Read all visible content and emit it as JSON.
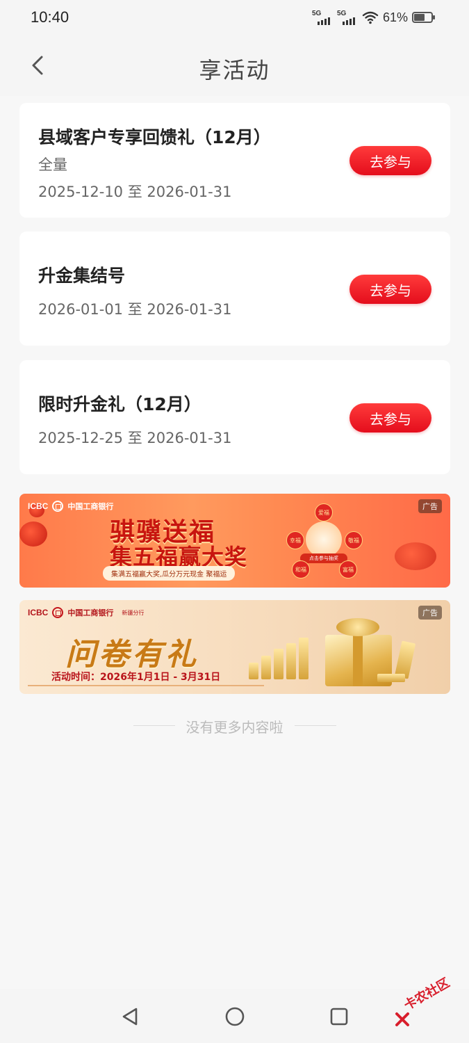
{
  "status_bar": {
    "time": "10:40",
    "signal1": "5G",
    "signal2": "5G",
    "battery_percent": "61%",
    "battery_level": 0.61
  },
  "header": {
    "title": "享活动"
  },
  "activities": [
    {
      "title": "县域客户专享回馈礼（12月）",
      "scope": "全量",
      "date": "2025-12-10 至 2026-01-31",
      "button": "去参与"
    },
    {
      "title": "升金集结号",
      "date": "2026-01-01 至 2026-01-31",
      "button": "去参与"
    },
    {
      "title": "限时升金礼（12月）",
      "date": "2025-12-25 至 2026-01-31",
      "button": "去参与"
    }
  ],
  "banners": [
    {
      "ad_tag": "广告",
      "bank": "中国工商银行",
      "logo_text": "ICBC",
      "headline1": "骐骥送福",
      "headline2": "集五福赢大奖",
      "subline": "集满五福赢大奖,瓜分万元现金 聚福运",
      "center_button": "点击参与抽奖",
      "fu_labels": [
        "爱福",
        "幸福",
        "敬福",
        "和福",
        "富福"
      ],
      "colors": {
        "bg": "#ff8a52",
        "headline": "#c8150f"
      }
    },
    {
      "ad_tag": "广告",
      "bank": "中国工商银行",
      "branch": "新疆分行",
      "logo_text": "ICBC",
      "headline": "问卷有礼",
      "time_text": "活动时间：2026年1月1日 - 3月31日",
      "colors": {
        "bg": "#f7dcbd",
        "headline": "#c87a16",
        "time": "#b9131a"
      }
    }
  ],
  "footer": {
    "no_more_text": "没有更多内容啦"
  },
  "watermark": {
    "text": "卡农社区"
  },
  "theme": {
    "accent": "#e40d1c",
    "background": "#f7f7f7"
  }
}
